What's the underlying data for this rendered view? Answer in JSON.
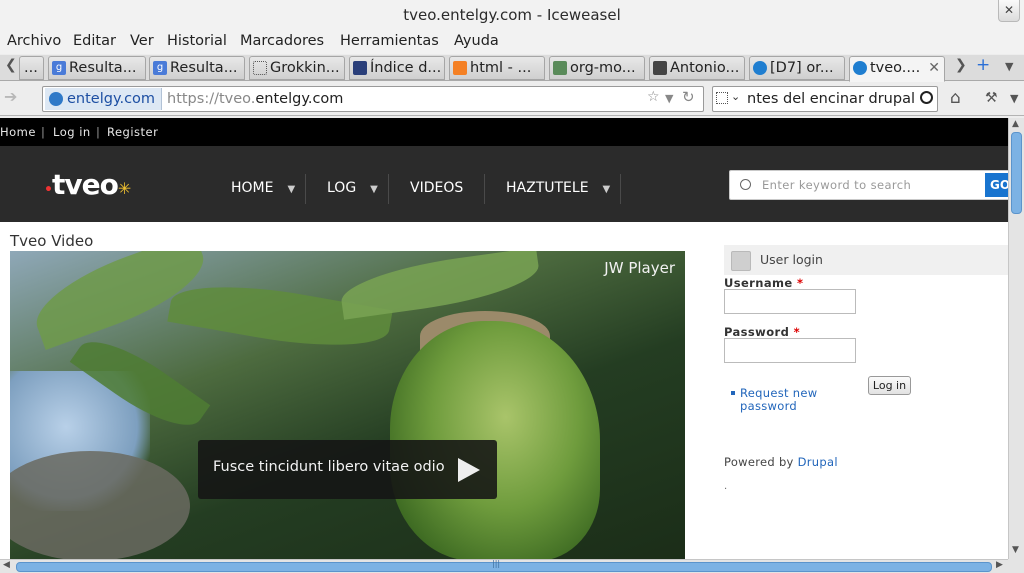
{
  "window": {
    "title": "tveo.entelgy.com - Iceweasel",
    "close_glyph": "✕"
  },
  "menu": [
    "Archivo",
    "Editar",
    "Ver",
    "Historial",
    "Marcadores",
    "Herramientas",
    "Ayuda"
  ],
  "tabs": [
    {
      "label": "...",
      "icon": "tab-icon",
      "active": false
    },
    {
      "label": "Resulta...",
      "icon": "google-icon",
      "active": false
    },
    {
      "label": "Resulta...",
      "icon": "google-icon",
      "active": false
    },
    {
      "label": "Grokkin...",
      "icon": "blank-page-icon",
      "active": false
    },
    {
      "label": "Índice d...",
      "icon": "monitor-icon",
      "active": false
    },
    {
      "label": "html - ...",
      "icon": "stackoverflow-icon",
      "active": false
    },
    {
      "label": "org-mo...",
      "icon": "unicorn-icon",
      "active": false
    },
    {
      "label": "Antonio...",
      "icon": "person-icon",
      "active": false
    },
    {
      "label": "[D7] or...",
      "icon": "drupal-icon",
      "active": false
    },
    {
      "label": "tveo....",
      "icon": "drupal-icon",
      "active": true
    }
  ],
  "nav": {
    "site_identity": "entelgy.com",
    "url_prefix": "https://tveo.",
    "url_host": "entelgy.com",
    "search_text": "ntes del encinar drupal"
  },
  "site": {
    "topbar": {
      "home": "Home",
      "login": "Log in",
      "register": "Register"
    },
    "logo": "tveo",
    "menu": [
      {
        "label": "HOME",
        "has_dropdown": true
      },
      {
        "label": "LOG",
        "has_dropdown": true
      },
      {
        "label": "VIDEOS",
        "has_dropdown": false
      },
      {
        "label": "HAZTUTELE",
        "has_dropdown": true
      }
    ],
    "search_placeholder": "Enter keyword to search",
    "search_button": "GO",
    "page_title": "Tveo Video",
    "video": {
      "watermark": "JW Player",
      "caption": "Fusce tincidunt libero vitae odio"
    },
    "login": {
      "title": "User login",
      "username_label": "Username",
      "password_label": "Password",
      "required_mark": "*",
      "submit": "Log in",
      "request_password": "Request new password"
    },
    "powered_prefix": "Powered by",
    "powered_link": "Drupal",
    "dot": "."
  },
  "colors": {
    "accent": "#1874cf",
    "header_bg": "#2b2b2b",
    "link": "#2266bb"
  }
}
